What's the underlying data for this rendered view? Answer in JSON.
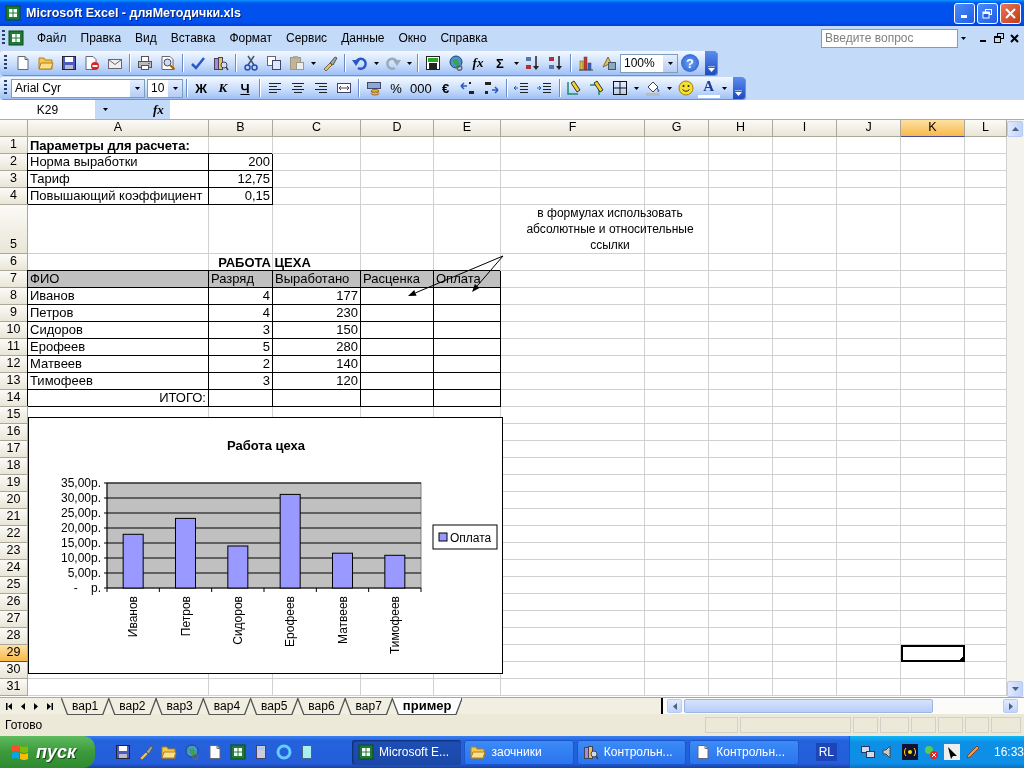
{
  "window": {
    "title": "Microsoft Excel - дляМетодички.xls"
  },
  "menu": {
    "items": [
      "Файл",
      "Правка",
      "Вид",
      "Вставка",
      "Формат",
      "Сервис",
      "Данные",
      "Окно",
      "Справка"
    ],
    "help_box": {
      "placeholder": "Введите вопрос"
    }
  },
  "standard_toolbar": {
    "function": "fx",
    "sum": "Σ",
    "zoom": "100%",
    "help": "?"
  },
  "formatting_toolbar": {
    "font": "Arial Cyr",
    "size": "10",
    "bold": "Ж",
    "italic": "К",
    "underline": "Ч",
    "percent": "%",
    "thousands": "000",
    "euro": "€",
    "font_color": "A"
  },
  "formula_bar": {
    "name_box": "K29",
    "function": "fx"
  },
  "sheet": {
    "columns": [
      {
        "label": "A",
        "selected": false
      },
      {
        "label": "B",
        "selected": false
      },
      {
        "label": "C",
        "selected": false
      },
      {
        "label": "D",
        "selected": false
      },
      {
        "label": "E",
        "selected": false
      },
      {
        "label": "F",
        "selected": false
      },
      {
        "label": "G",
        "selected": false
      },
      {
        "label": "H",
        "selected": false
      },
      {
        "label": "I",
        "selected": false
      },
      {
        "label": "J",
        "selected": false
      },
      {
        "label": "K",
        "selected": true
      },
      {
        "label": "L",
        "selected": false
      }
    ],
    "rows": [
      {
        "number": "1",
        "selected": false,
        "kind": "heading",
        "cells": [
          "Параметры для расчета:"
        ]
      },
      {
        "number": "2",
        "selected": false,
        "kind": "param",
        "cells": [
          "Норма выработки",
          "200"
        ]
      },
      {
        "number": "3",
        "selected": false,
        "kind": "param",
        "cells": [
          "Тариф",
          "12,75"
        ]
      },
      {
        "number": "4",
        "selected": false,
        "kind": "param",
        "cells": [
          "Повышающий коэффициент",
          "0,15"
        ]
      },
      {
        "number": "5",
        "selected": false,
        "kind": "blank"
      },
      {
        "number": "6",
        "selected": false,
        "kind": "title",
        "cells": [
          "РАБОТА ЦЕХА"
        ]
      },
      {
        "number": "7",
        "selected": false,
        "kind": "header",
        "cells": [
          "ФИО",
          "Разряд",
          "Выработано",
          "Расценка",
          "Оплата"
        ]
      },
      {
        "number": "8",
        "selected": false,
        "kind": "data",
        "cells": [
          "Иванов",
          "4",
          "177"
        ]
      },
      {
        "number": "9",
        "selected": false,
        "kind": "data",
        "cells": [
          "Петров",
          "4",
          "230"
        ]
      },
      {
        "number": "10",
        "selected": false,
        "kind": "data",
        "cells": [
          "Сидоров",
          "3",
          "150"
        ]
      },
      {
        "number": "11",
        "selected": false,
        "kind": "data",
        "cells": [
          "Ерофеев",
          "5",
          "280"
        ]
      },
      {
        "number": "12",
        "selected": false,
        "kind": "data",
        "cells": [
          "Матвеев",
          "2",
          "140"
        ]
      },
      {
        "number": "13",
        "selected": false,
        "kind": "data",
        "cells": [
          "Тимофеев",
          "3",
          "120"
        ]
      },
      {
        "number": "14",
        "selected": false,
        "kind": "total",
        "cells": [
          "ИТОГО:"
        ]
      },
      {
        "number": "15",
        "selected": false,
        "kind": "blank"
      },
      {
        "number": "16",
        "selected": false,
        "kind": "blank"
      },
      {
        "number": "17",
        "selected": false,
        "kind": "blank"
      },
      {
        "number": "18",
        "selected": false,
        "kind": "blank"
      },
      {
        "number": "19",
        "selected": false,
        "kind": "blank"
      },
      {
        "number": "20",
        "selected": false,
        "kind": "blank"
      },
      {
        "number": "21",
        "selected": false,
        "kind": "blank"
      },
      {
        "number": "22",
        "selected": false,
        "kind": "blank"
      },
      {
        "number": "23",
        "selected": false,
        "kind": "blank"
      },
      {
        "number": "24",
        "selected": false,
        "kind": "blank"
      },
      {
        "number": "25",
        "selected": false,
        "kind": "blank"
      },
      {
        "number": "26",
        "selected": false,
        "kind": "blank"
      },
      {
        "number": "27",
        "selected": false,
        "kind": "blank"
      },
      {
        "number": "28",
        "selected": false,
        "kind": "blank"
      },
      {
        "number": "29",
        "selected": true,
        "kind": "blank"
      },
      {
        "number": "30",
        "selected": false,
        "kind": "blank"
      },
      {
        "number": "31",
        "selected": false,
        "kind": "blank"
      }
    ],
    "note": "в формулах использовать абсолютные и относительные ссылки",
    "chart_data": {
      "type": "bar",
      "title": "Работа цеха",
      "categories": [
        "Иванов",
        "Петров",
        "Сидоров",
        "Ерофеев",
        "Матвеев",
        "Тимофеев"
      ],
      "series": [
        {
          "name": "Оплата",
          "color": "#9999ff",
          "values": [
            17.9,
            23.2,
            14.0,
            31.2,
            11.6,
            10.9
          ]
        }
      ],
      "ylim": [
        0,
        35
      ],
      "grid": true,
      "yticks": [
        {
          "value": 0,
          "label": "-    р."
        },
        {
          "value": 5,
          "label": "5,00р."
        },
        {
          "value": 10,
          "label": "10,00р."
        },
        {
          "value": 15,
          "label": "15,00р."
        },
        {
          "value": 20,
          "label": "20,00р."
        },
        {
          "value": 25,
          "label": "25,00р."
        },
        {
          "value": 30,
          "label": "30,00р."
        },
        {
          "value": 35,
          "label": "35,00р."
        }
      ]
    }
  },
  "sheet_tabs": [
    {
      "label": "вар1",
      "selected": false
    },
    {
      "label": "вар2",
      "selected": false
    },
    {
      "label": "вар3",
      "selected": false
    },
    {
      "label": "вар4",
      "selected": false
    },
    {
      "label": "вар5",
      "selected": false
    },
    {
      "label": "вар6",
      "selected": false
    },
    {
      "label": "вар7",
      "selected": false
    },
    {
      "label": "пример",
      "selected": true
    }
  ],
  "status_bar": {
    "text": "Готово"
  },
  "taskbar": {
    "start": "пуск",
    "tasks": [
      {
        "label": "Microsoft E...",
        "selected": true
      },
      {
        "label": "заочники",
        "selected": false
      },
      {
        "label": "Контрольн...",
        "selected": false
      },
      {
        "label": "Контрольн...",
        "selected": false
      }
    ],
    "language": "RL",
    "clock": "16:33"
  }
}
